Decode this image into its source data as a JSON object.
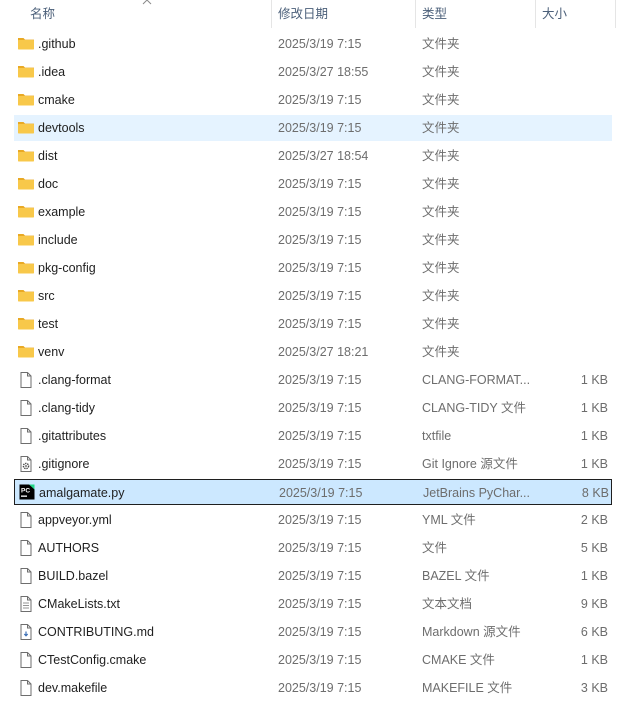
{
  "columns": {
    "name": "名称",
    "date": "修改日期",
    "type": "类型",
    "size": "大小"
  },
  "colors": {
    "folder": "#f8c84a",
    "folder_dark": "#e9a924",
    "hover": "#e5f3ff",
    "selected": "#cce8ff"
  },
  "rows": [
    {
      "name": ".github",
      "date": "2025/3/19 7:15",
      "type": "文件夹",
      "size": "",
      "icon": "folder-icon"
    },
    {
      "name": ".idea",
      "date": "2025/3/27 18:55",
      "type": "文件夹",
      "size": "",
      "icon": "folder-icon"
    },
    {
      "name": "cmake",
      "date": "2025/3/19 7:15",
      "type": "文件夹",
      "size": "",
      "icon": "folder-icon"
    },
    {
      "name": "devtools",
      "date": "2025/3/19 7:15",
      "type": "文件夹",
      "size": "",
      "icon": "folder-icon",
      "state": "hover"
    },
    {
      "name": "dist",
      "date": "2025/3/27 18:54",
      "type": "文件夹",
      "size": "",
      "icon": "folder-icon"
    },
    {
      "name": "doc",
      "date": "2025/3/19 7:15",
      "type": "文件夹",
      "size": "",
      "icon": "folder-icon"
    },
    {
      "name": "example",
      "date": "2025/3/19 7:15",
      "type": "文件夹",
      "size": "",
      "icon": "folder-icon"
    },
    {
      "name": "include",
      "date": "2025/3/19 7:15",
      "type": "文件夹",
      "size": "",
      "icon": "folder-icon"
    },
    {
      "name": "pkg-config",
      "date": "2025/3/19 7:15",
      "type": "文件夹",
      "size": "",
      "icon": "folder-icon"
    },
    {
      "name": "src",
      "date": "2025/3/19 7:15",
      "type": "文件夹",
      "size": "",
      "icon": "folder-icon"
    },
    {
      "name": "test",
      "date": "2025/3/19 7:15",
      "type": "文件夹",
      "size": "",
      "icon": "folder-icon"
    },
    {
      "name": "venv",
      "date": "2025/3/27 18:21",
      "type": "文件夹",
      "size": "",
      "icon": "folder-icon"
    },
    {
      "name": ".clang-format",
      "date": "2025/3/19 7:15",
      "type": "CLANG-FORMAT...",
      "size": "1 KB",
      "icon": "file-icon"
    },
    {
      "name": ".clang-tidy",
      "date": "2025/3/19 7:15",
      "type": "CLANG-TIDY 文件",
      "size": "1 KB",
      "icon": "file-icon"
    },
    {
      "name": ".gitattributes",
      "date": "2025/3/19 7:15",
      "type": "txtfile",
      "size": "1 KB",
      "icon": "file-icon"
    },
    {
      "name": ".gitignore",
      "date": "2025/3/19 7:15",
      "type": "Git Ignore 源文件",
      "size": "1 KB",
      "icon": "gear-file-icon"
    },
    {
      "name": "amalgamate.py",
      "date": "2025/3/19 7:15",
      "type": "JetBrains PyChar...",
      "size": "8 KB",
      "icon": "pycharm-icon",
      "state": "selected"
    },
    {
      "name": "appveyor.yml",
      "date": "2025/3/19 7:15",
      "type": "YML 文件",
      "size": "2 KB",
      "icon": "file-icon"
    },
    {
      "name": "AUTHORS",
      "date": "2025/3/19 7:15",
      "type": "文件",
      "size": "5 KB",
      "icon": "file-icon"
    },
    {
      "name": "BUILD.bazel",
      "date": "2025/3/19 7:15",
      "type": "BAZEL 文件",
      "size": "1 KB",
      "icon": "file-icon"
    },
    {
      "name": "CMakeLists.txt",
      "date": "2025/3/19 7:15",
      "type": "文本文档",
      "size": "9 KB",
      "icon": "text-file-icon"
    },
    {
      "name": "CONTRIBUTING.md",
      "date": "2025/3/19 7:15",
      "type": "Markdown 源文件",
      "size": "6 KB",
      "icon": "markdown-file-icon"
    },
    {
      "name": "CTestConfig.cmake",
      "date": "2025/3/19 7:15",
      "type": "CMAKE 文件",
      "size": "1 KB",
      "icon": "file-icon"
    },
    {
      "name": "dev.makefile",
      "date": "2025/3/19 7:15",
      "type": "MAKEFILE 文件",
      "size": "3 KB",
      "icon": "file-icon"
    }
  ]
}
